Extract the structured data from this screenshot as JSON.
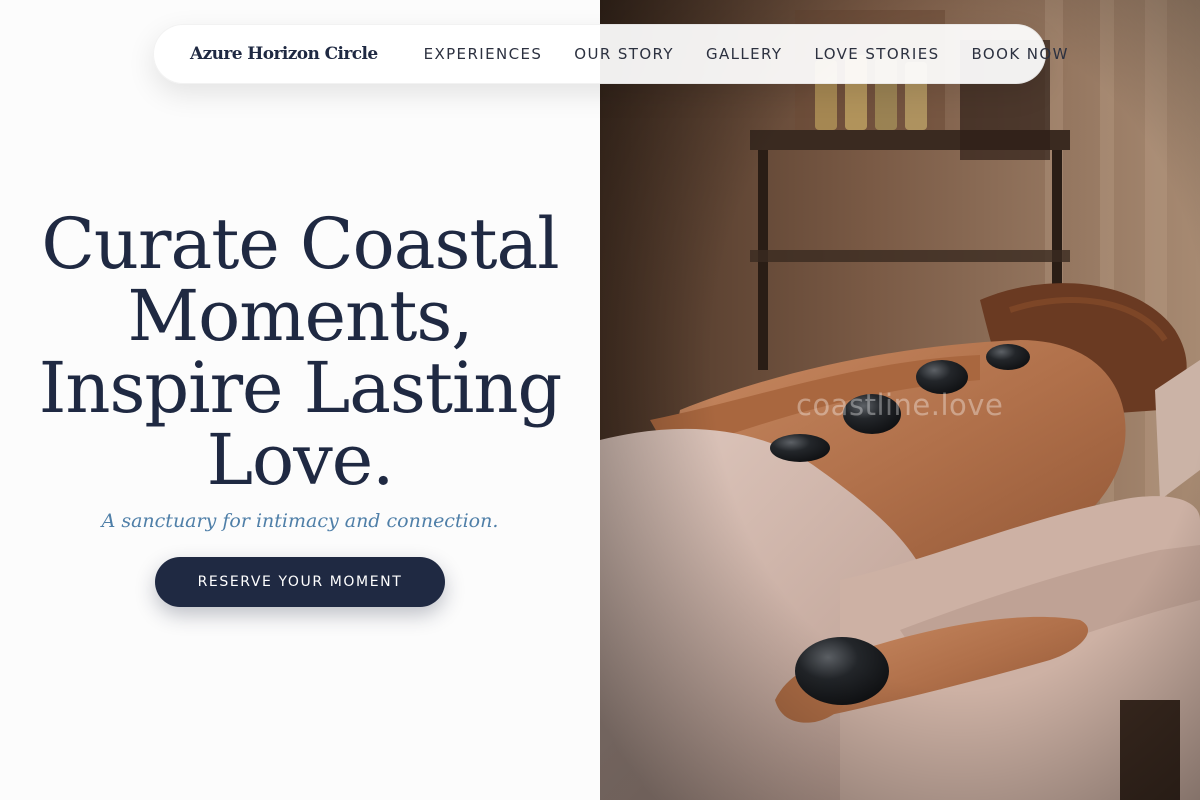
{
  "brand": {
    "name": "Azure Horizon Circle"
  },
  "nav": {
    "items": [
      {
        "label": "EXPERIENCES"
      },
      {
        "label": "OUR STORY"
      },
      {
        "label": "GALLERY"
      },
      {
        "label": "LOVE STORIES"
      },
      {
        "label": "BOOK NOW"
      }
    ]
  },
  "hero": {
    "title": "Curate Coastal Moments, Inspire Lasting Love.",
    "subtitle": "A sanctuary for intimacy and connection.",
    "cta_label": "RESERVE YOUR MOMENT"
  },
  "image": {
    "watermark": "coastline.love",
    "description": "hot stone massage, woman lying face down on a massage table"
  },
  "colors": {
    "navy": "#1f2942",
    "subtitle_blue": "#4f7fa8",
    "background": "#fcfcfc"
  }
}
